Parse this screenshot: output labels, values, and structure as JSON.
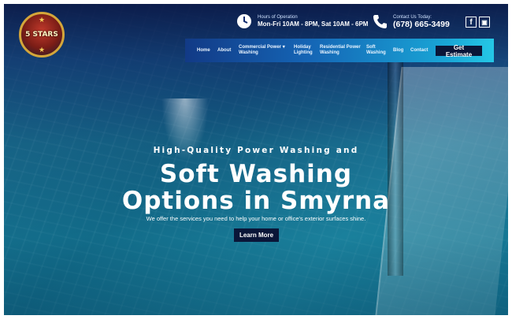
{
  "logo": {
    "text": "5 STARS"
  },
  "info": {
    "hours_label": "Hours of Operation",
    "hours_value": "Mon-Fri 10AM - 8PM, Sat 10AM - 6PM",
    "contact_label": "Contact Us Today:",
    "contact_value": "(678) 665-3499"
  },
  "social": {
    "facebook": "f",
    "other": "▣"
  },
  "nav": {
    "home": "Home",
    "about": "About",
    "commercial_1": "Commercial Power",
    "commercial_2": "Washing",
    "dropdown": "▾",
    "holiday_1": "Holiday",
    "holiday_2": "Lighting",
    "residential_1": "Residential Power",
    "residential_2": "Washing",
    "soft_1": "Soft",
    "soft_2": "Washing",
    "blog": "Blog",
    "contact": "Contact",
    "estimate": "Get Estimate"
  },
  "hero": {
    "subtitle": "High-Quality Power Washing and",
    "title_line1": "Soft Washing",
    "title_line2": "Options in Smyrna",
    "description": "We offer the services you need to help your home or office's exterior surfaces shine.",
    "button": "Learn More"
  },
  "colors": {
    "accent": "#19a6d6",
    "dark_button": "#0a1638",
    "logo_ring": "#d4a63a"
  }
}
